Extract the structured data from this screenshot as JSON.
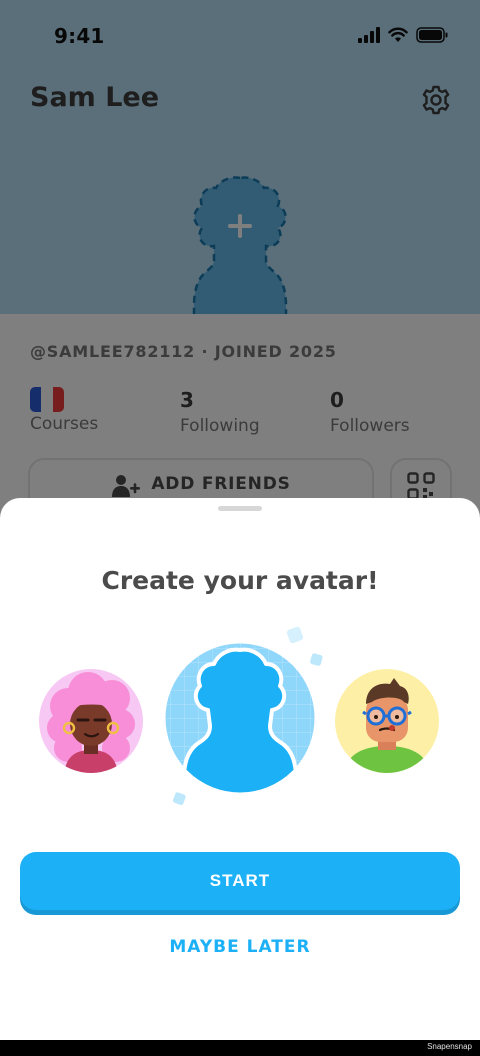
{
  "status_bar": {
    "time": "9:41"
  },
  "profile": {
    "name": "Sam Lee",
    "username_joined": "@SAMLEE782112 · JOINED 2025",
    "stats": [
      {
        "value": "",
        "label": "Courses",
        "flag": "fr"
      },
      {
        "value": "3",
        "label": "Following"
      },
      {
        "value": "0",
        "label": "Followers"
      }
    ],
    "add_friends_label": "ADD FRIENDS"
  },
  "sheet": {
    "title": "Create your avatar!",
    "start_label": "START",
    "maybe_later_label": "MAYBE LATER"
  },
  "footer": {
    "watermark": "Snapensnap"
  },
  "colors": {
    "hero_bg": "#b4def3",
    "accent_blue": "#1cb0f6",
    "accent_blue_dark": "#1899d6",
    "text_dark": "#4b4b4b",
    "text_muted": "#777777"
  },
  "icons": [
    "gear-icon",
    "signal-icon",
    "wifi-icon",
    "battery-icon",
    "add-photo-icon",
    "add-friend-icon",
    "qr-code-icon",
    "france-flag-icon"
  ]
}
